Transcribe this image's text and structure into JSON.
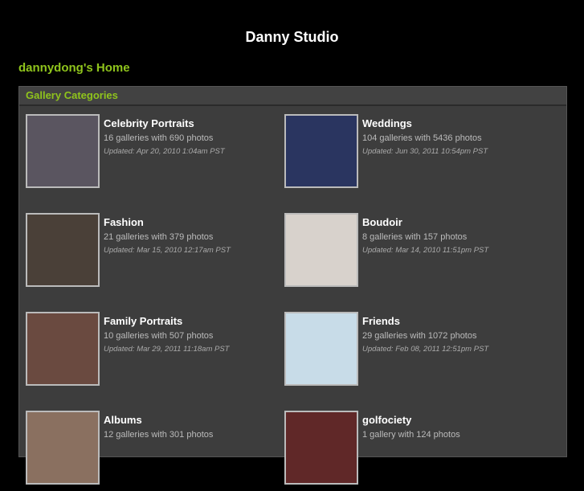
{
  "site_title": "Danny Studio",
  "home_link": "dannydong's Home",
  "panel_title": "Gallery Categories",
  "categories": [
    {
      "title": "Celebrity Portraits",
      "count": "16 galleries with 690 photos",
      "updated": "Updated: Apr 20, 2010 1:04am PST",
      "color": "#5a5560"
    },
    {
      "title": "Weddings",
      "count": "104 galleries with 5436 photos",
      "updated": "Updated: Jun 30, 2011 10:54pm PST",
      "color": "#2a3560"
    },
    {
      "title": "Fashion",
      "count": "21 galleries with 379 photos",
      "updated": "Updated: Mar 15, 2010 12:17am PST",
      "color": "#4a4038"
    },
    {
      "title": "Boudoir",
      "count": "8 galleries with 157 photos",
      "updated": "Updated: Mar 14, 2010 11:51pm PST",
      "color": "#d8d2cc"
    },
    {
      "title": "Family Portraits",
      "count": "10 galleries with 507 photos",
      "updated": "Updated: Mar 29, 2011 11:18am PST",
      "color": "#6a4a40"
    },
    {
      "title": "Friends",
      "count": "29 galleries with 1072 photos",
      "updated": "Updated: Feb 08, 2011 12:51pm PST",
      "color": "#c8dce8"
    },
    {
      "title": "Albums",
      "count": "12 galleries with 301 photos",
      "updated": "",
      "color": "#8a7060"
    },
    {
      "title": "golfociety",
      "count": "1 gallery with 124 photos",
      "updated": "",
      "color": "#602828"
    }
  ]
}
